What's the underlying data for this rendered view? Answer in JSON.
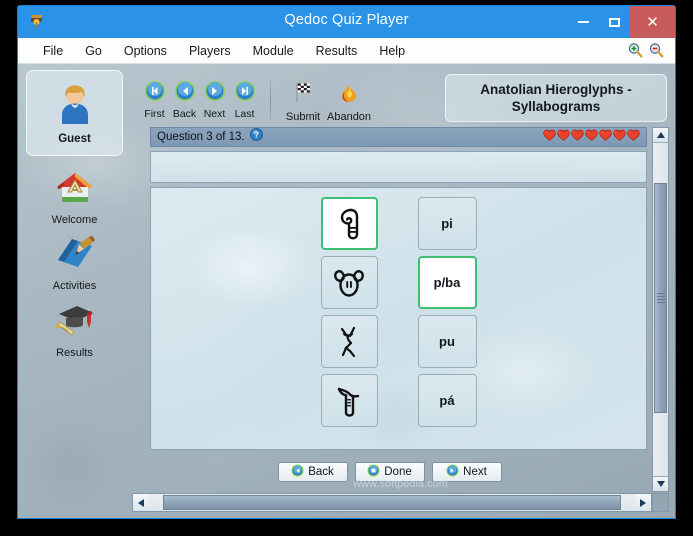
{
  "window": {
    "title": "Qedoc Quiz Player",
    "app_icon": "quiz-player-icon",
    "minimize": "minimize-button",
    "maximize": "maximize-button",
    "close_glyph": "✕"
  },
  "menubar": {
    "items": [
      {
        "label": "File"
      },
      {
        "label": "Go"
      },
      {
        "label": "Options"
      },
      {
        "label": "Players"
      },
      {
        "label": "Module"
      },
      {
        "label": "Results"
      },
      {
        "label": "Help"
      }
    ],
    "zoom_in_icon": "zoom-in-icon",
    "zoom_out_icon": "zoom-out-icon"
  },
  "sidebar": {
    "user": {
      "name": "Guest",
      "icon": "user-avatar-icon"
    },
    "items": [
      {
        "label": "Welcome",
        "icon": "home-icon"
      },
      {
        "label": "Activities",
        "icon": "book-pen-icon"
      },
      {
        "label": "Results",
        "icon": "graduation-cap-icon"
      }
    ]
  },
  "toolbar": {
    "nav": [
      {
        "label": "First",
        "icon": "skip-first-icon"
      },
      {
        "label": "Back",
        "icon": "previous-icon"
      },
      {
        "label": "Next",
        "icon": "next-icon"
      },
      {
        "label": "Last",
        "icon": "skip-last-icon"
      }
    ],
    "actions": [
      {
        "label": "Submit",
        "icon": "checkered-flag-icon"
      },
      {
        "label": "Abandon",
        "icon": "flame-icon"
      }
    ]
  },
  "module": {
    "title_line1": "Anatolian Hieroglyphs -",
    "title_line2": "Syllabograms"
  },
  "quiz": {
    "question_status": "Question 3 of 13.",
    "help_icon": "help-question-icon",
    "lives_count": 7,
    "life_icon": "heart-icon",
    "question_text": "",
    "glyphs": [
      {
        "name": "glyph-spiral-hook",
        "selected": true
      },
      {
        "name": "glyph-animal-head",
        "selected": false
      },
      {
        "name": "glyph-figure",
        "selected": false
      },
      {
        "name": "glyph-vessel",
        "selected": false
      }
    ],
    "answers": [
      {
        "label": "pi",
        "selected": false
      },
      {
        "label": "p/ba",
        "selected": true
      },
      {
        "label": "pu",
        "selected": false
      },
      {
        "label": "pá",
        "selected": false
      }
    ],
    "buttons": [
      {
        "label": "Back",
        "icon": "back-circle-icon"
      },
      {
        "label": "Done",
        "icon": "done-circle-icon"
      },
      {
        "label": "Next",
        "icon": "next-circle-icon"
      }
    ]
  },
  "colors": {
    "titlebar": "#2a93e8",
    "close": "#c75b5b",
    "selected_border": "#3fbf72",
    "heart": "#e8412c",
    "header_band": "#8ba4bd"
  },
  "watermark": "www.softpedia.com"
}
